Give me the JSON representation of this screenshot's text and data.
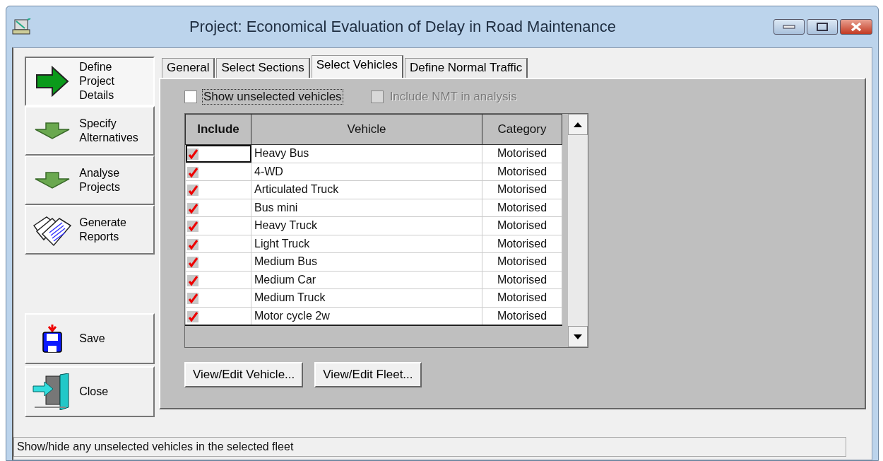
{
  "window": {
    "title": "Project: Economical Evaluation of Delay in Road Maintenance"
  },
  "nav": [
    {
      "label": "Define Project Details",
      "kind": "arrow-right",
      "selected": true
    },
    {
      "label": "Specify Alternatives",
      "kind": "arrow-down",
      "selected": false
    },
    {
      "label": "Analyse Projects",
      "kind": "arrow-down",
      "selected": false
    },
    {
      "label": "Generate Reports",
      "kind": "reports",
      "selected": false
    }
  ],
  "actions": [
    {
      "label": "Save",
      "kind": "save"
    },
    {
      "label": "Close",
      "kind": "close"
    }
  ],
  "tabs": [
    {
      "label": "General",
      "selected": false
    },
    {
      "label": "Select Sections",
      "selected": false
    },
    {
      "label": "Select Vehicles",
      "selected": true
    },
    {
      "label": "Define Normal Traffic",
      "selected": false
    }
  ],
  "options": [
    {
      "label": "Show unselected vehicles",
      "checked": false,
      "disabled": false
    },
    {
      "label": "Include NMT in analysis",
      "checked": false,
      "disabled": true
    }
  ],
  "table": {
    "columns": [
      "Include",
      "Vehicle",
      "Category"
    ],
    "rows": [
      {
        "include": true,
        "focused": true,
        "vehicle": "Heavy Bus",
        "category": "Motorised"
      },
      {
        "include": true,
        "focused": false,
        "vehicle": "4-WD",
        "category": "Motorised"
      },
      {
        "include": true,
        "focused": false,
        "vehicle": "Articulated Truck",
        "category": "Motorised"
      },
      {
        "include": true,
        "focused": false,
        "vehicle": "Bus mini",
        "category": "Motorised"
      },
      {
        "include": true,
        "focused": false,
        "vehicle": "Heavy Truck",
        "category": "Motorised"
      },
      {
        "include": true,
        "focused": false,
        "vehicle": "Light Truck",
        "category": "Motorised"
      },
      {
        "include": true,
        "focused": false,
        "vehicle": "Medium Bus",
        "category": "Motorised"
      },
      {
        "include": true,
        "focused": false,
        "vehicle": "Medium Car",
        "category": "Motorised"
      },
      {
        "include": true,
        "focused": false,
        "vehicle": "Medium Truck",
        "category": "Motorised"
      },
      {
        "include": true,
        "focused": false,
        "vehicle": "Motor cycle 2w",
        "category": "Motorised"
      }
    ]
  },
  "buttons": [
    "View/Edit Vehicle...",
    "View/Edit Fleet..."
  ],
  "status_bar": "Show/hide any unselected vehicles in the selected fleet"
}
